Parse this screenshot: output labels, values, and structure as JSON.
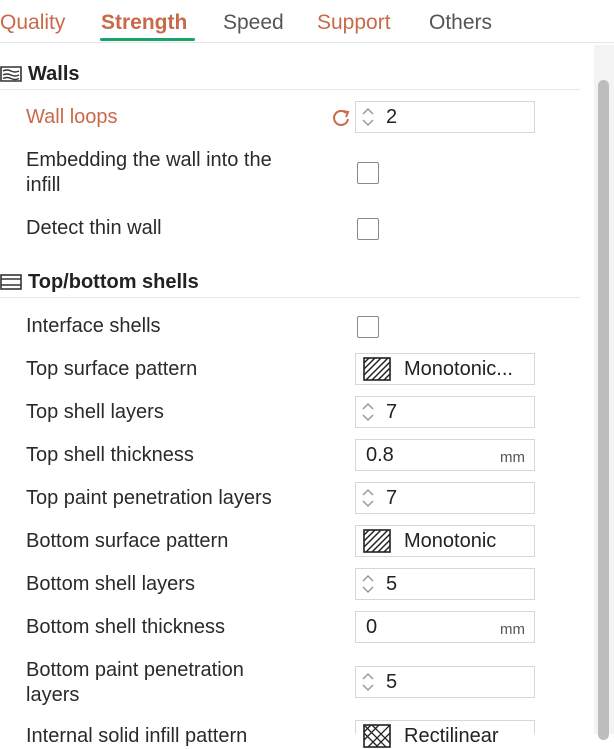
{
  "tabs": [
    {
      "label": "Quality",
      "state": "modified"
    },
    {
      "label": "Strength",
      "state": "active"
    },
    {
      "label": "Speed",
      "state": "plain"
    },
    {
      "label": "Support",
      "state": "modified"
    },
    {
      "label": "Others",
      "state": "plain"
    }
  ],
  "colors": {
    "accent": "#1aa36a",
    "modified": "#c9694a"
  },
  "walls": {
    "title": "Walls",
    "icon": "walls-icon",
    "wall_loops": {
      "label": "Wall loops",
      "value": "2"
    },
    "embedding": {
      "label_line1": "Embedding the wall into the",
      "label_line2": "infill",
      "checked": false
    },
    "detect_thin": {
      "label": "Detect thin wall",
      "checked": false
    }
  },
  "shells": {
    "title": "Top/bottom shells",
    "icon": "shells-icon",
    "interface_shells": {
      "label": "Interface shells",
      "checked": false
    },
    "top_surface_pattern": {
      "label": "Top surface pattern",
      "value": "Monotonic..."
    },
    "top_shell_layers": {
      "label": "Top shell layers",
      "value": "7"
    },
    "top_shell_thickness": {
      "label": "Top shell thickness",
      "value": "0.8",
      "unit": "mm"
    },
    "top_paint_layers": {
      "label": "Top paint penetration layers",
      "value": "7"
    },
    "bottom_surface_pattern": {
      "label": "Bottom surface pattern",
      "value": "Monotonic"
    },
    "bottom_shell_layers": {
      "label": "Bottom shell layers",
      "value": "5"
    },
    "bottom_shell_thickness": {
      "label": "Bottom shell thickness",
      "value": "0",
      "unit": "mm"
    },
    "bottom_paint_layers": {
      "label_line1": "Bottom paint penetration",
      "label_line2": "layers",
      "value": "5"
    },
    "internal_solid_infill": {
      "label": "Internal solid infill pattern",
      "value": "Rectilinear"
    }
  }
}
